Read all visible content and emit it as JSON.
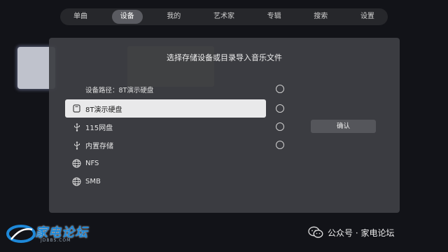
{
  "nav": {
    "tabs": [
      {
        "label": "单曲"
      },
      {
        "label": "设备",
        "active": true
      },
      {
        "label": "我的"
      },
      {
        "label": "艺术家"
      },
      {
        "label": "专辑"
      },
      {
        "label": "搜索"
      },
      {
        "label": "设置"
      }
    ]
  },
  "dialog": {
    "title": "选择存储设备或目录导入音乐文件",
    "path_label": "设备路径：8T演示硬盘",
    "confirm_label": "确认",
    "devices": [
      {
        "label": "8T演示硬盘",
        "icon": "hard-drive-icon",
        "selected": true
      },
      {
        "label": "115网盘",
        "icon": "usb-icon"
      },
      {
        "label": "内置存储",
        "icon": "usb-icon"
      },
      {
        "label": "NFS",
        "icon": "globe-icon"
      },
      {
        "label": "SMB",
        "icon": "globe-icon"
      }
    ]
  },
  "watermark": {
    "logo_text": "家电论坛",
    "logo_sub": "JDBBS.COM",
    "wechat_text": "公众号 · 家电论坛"
  },
  "colors": {
    "background": "#121318",
    "dialog": "#3e3f44",
    "selected_row": "#e9e9ea",
    "active_tab": "#5a5b61",
    "logo_blue": "#1e88d8"
  }
}
